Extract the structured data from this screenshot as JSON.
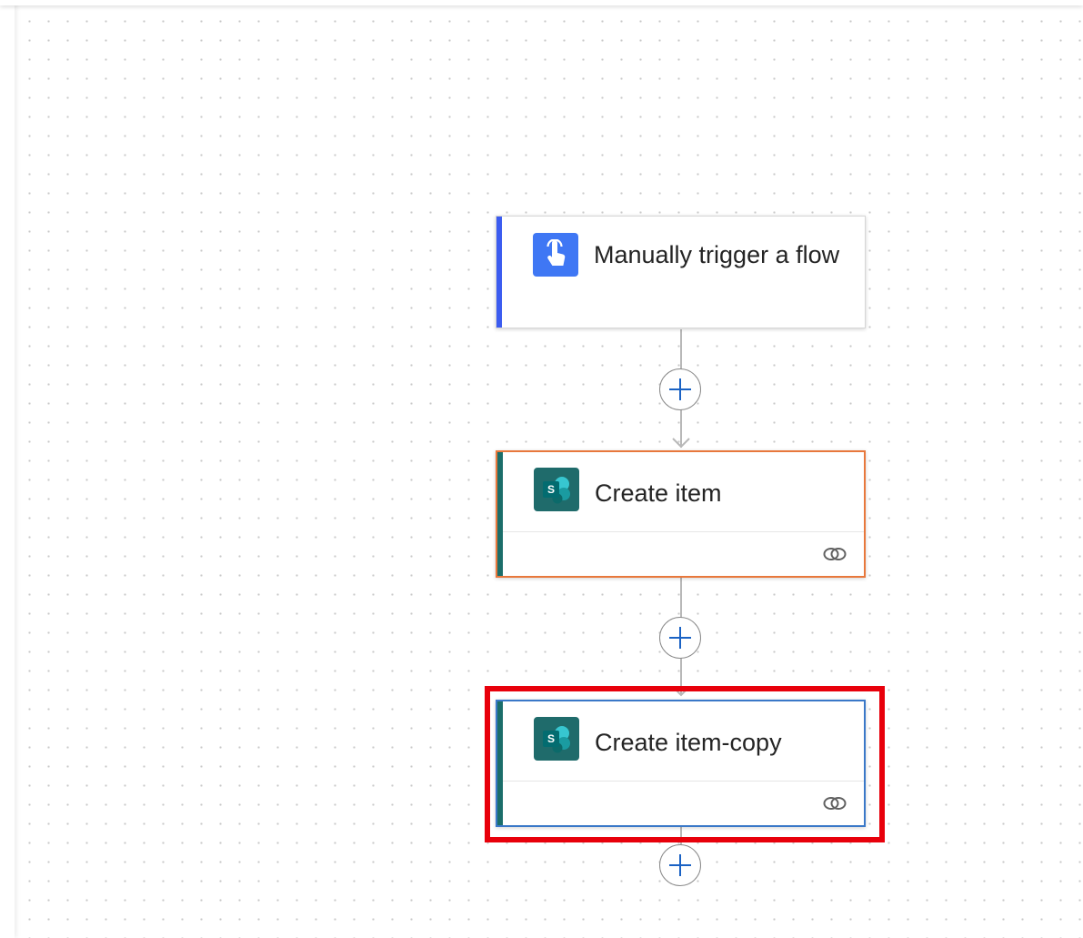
{
  "canvas": {
    "background": "#ffffff",
    "dot_color": "#c8c8c8"
  },
  "nodes": [
    {
      "id": "trigger",
      "title": "Manually trigger a flow",
      "icon": "hand-touch-icon",
      "icon_color": "#3f77f4",
      "accent_color": "#3b5cf0",
      "selected": false
    },
    {
      "id": "create-item",
      "title": "Create item",
      "icon": "sharepoint-icon",
      "icon_color": "#1f6b6b",
      "accent_color": "#1b6e6a",
      "border_color": "#e8783c",
      "has_link_icon": true
    },
    {
      "id": "create-item-copy",
      "title": "Create item-copy",
      "icon": "sharepoint-icon",
      "icon_color": "#1f6b6b",
      "accent_color": "#1b6e6a",
      "border_color": "#3a78c8",
      "has_link_icon": true,
      "highlighted": true
    }
  ],
  "annotation": {
    "highlight_color": "#e8000b"
  },
  "add_step_button": {
    "icon": "plus-icon",
    "color": "#1a62c4"
  }
}
